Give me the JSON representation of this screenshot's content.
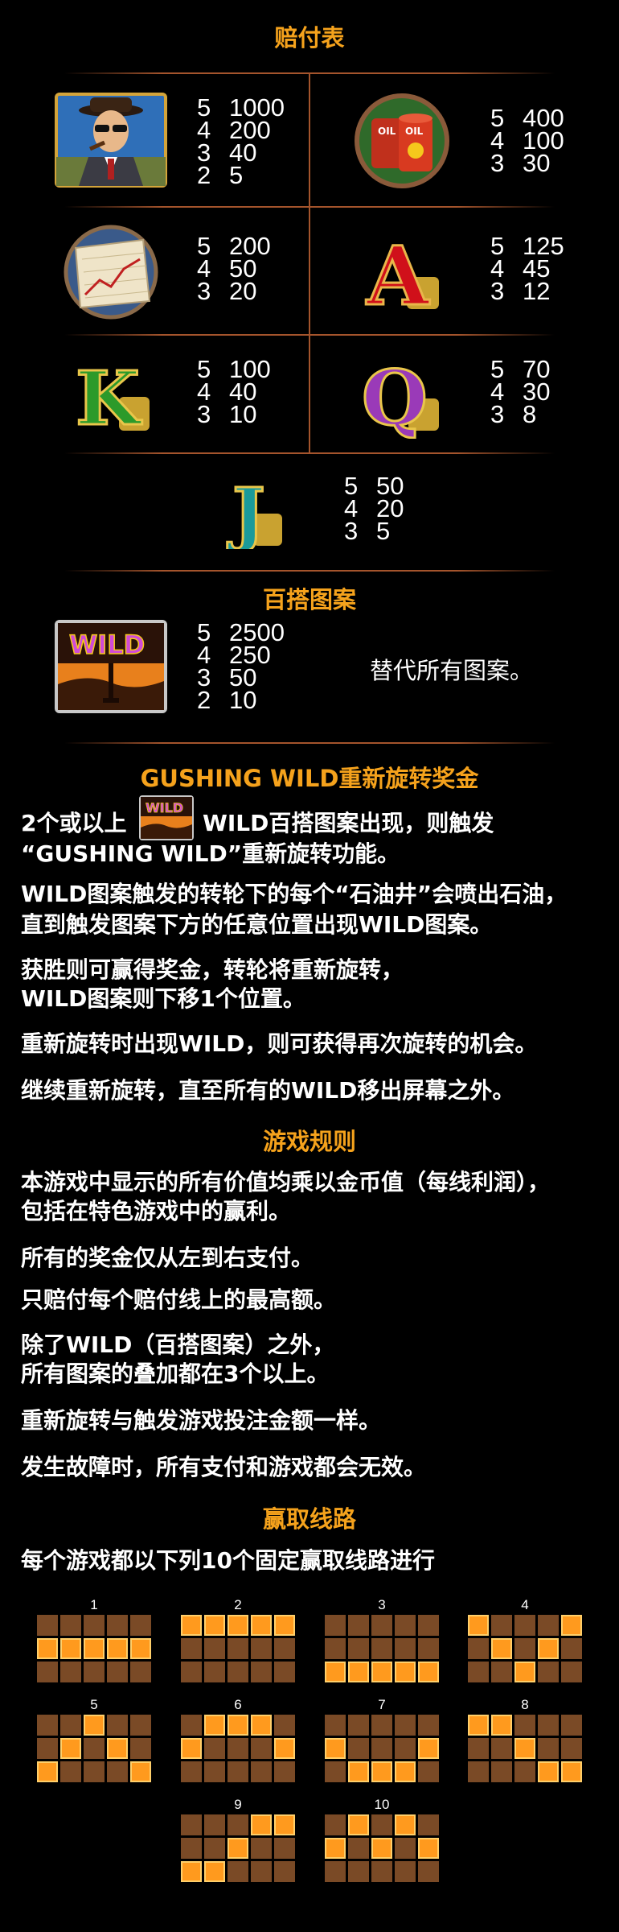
{
  "paytable_title": "赔付表",
  "symbols": [
    {
      "id": "man",
      "pays": [
        [
          "5",
          "1000"
        ],
        [
          "4",
          "200"
        ],
        [
          "3",
          "40"
        ],
        [
          "2",
          "5"
        ]
      ]
    },
    {
      "id": "barrels",
      "pays": [
        [
          "5",
          "400"
        ],
        [
          "4",
          "100"
        ],
        [
          "3",
          "30"
        ]
      ]
    },
    {
      "id": "stock",
      "pays": [
        [
          "5",
          "200"
        ],
        [
          "4",
          "50"
        ],
        [
          "3",
          "20"
        ]
      ]
    },
    {
      "id": "A",
      "pays": [
        [
          "5",
          "125"
        ],
        [
          "4",
          "45"
        ],
        [
          "3",
          "12"
        ]
      ]
    },
    {
      "id": "K",
      "pays": [
        [
          "5",
          "100"
        ],
        [
          "4",
          "40"
        ],
        [
          "3",
          "10"
        ]
      ]
    },
    {
      "id": "Q",
      "pays": [
        [
          "5",
          "70"
        ],
        [
          "4",
          "30"
        ],
        [
          "3",
          "8"
        ]
      ]
    },
    {
      "id": "J",
      "pays": [
        [
          "5",
          "50"
        ],
        [
          "4",
          "20"
        ],
        [
          "3",
          "5"
        ]
      ]
    }
  ],
  "wild_title": "百搭图案",
  "wild_logo_text": "WILD",
  "wild_pays": [
    [
      "5",
      "2500"
    ],
    [
      "4",
      "250"
    ],
    [
      "3",
      "50"
    ],
    [
      "2",
      "10"
    ]
  ],
  "wild_desc": "替代所有图案。",
  "gushing_title": "GUSHING WILD重新旋转奖金",
  "gushing_line1a": "2个或以上",
  "gushing_line1b": "WILD百搭图案出现，则触发",
  "gushing_line2": "“GUSHING WILD”重新旋转功能。",
  "gushing_p2_1": "WILD图案触发的转轮下的每个“石油井”会喷出石油，",
  "gushing_p2_2": "直到触发图案下方的任意位置出现WILD图案。",
  "gushing_p3_1": "获胜则可赢得奖金，转轮将重新旋转，",
  "gushing_p3_2": "WILD图案则下移1个位置。",
  "gushing_p4": "重新旋转时出现WILD，则可获得再次旋转的机会。",
  "gushing_p5": "继续重新旋转，直至所有的WILD移出屏幕之外。",
  "rules_title": "游戏规则",
  "rules_p1_1": "本游戏中显示的所有价值均乘以金币值（每线利润），",
  "rules_p1_2": "包括在特色游戏中的赢利。",
  "rules_p2": "所有的奖金仅从左到右支付。",
  "rules_p3": "只赔付每个赔付线上的最高额。",
  "rules_p4_1": "除了WILD（百搭图案）之外，",
  "rules_p4_2": "所有图案的叠加都在3个以上。",
  "rules_p5": "重新旋转与触发游戏投注金额一样。",
  "rules_p6": "发生故障时，所有支付和游戏都会无效。",
  "lines_title": "赢取线路",
  "lines_desc": "每个游戏都以下列10个固定赢取线路进行",
  "paylines": [
    {
      "label": "1",
      "rows": [
        1,
        1,
        1,
        1,
        1
      ]
    },
    {
      "label": "2",
      "rows": [
        0,
        0,
        0,
        0,
        0
      ]
    },
    {
      "label": "3",
      "rows": [
        2,
        2,
        2,
        2,
        2
      ]
    },
    {
      "label": "4",
      "rows": [
        0,
        1,
        2,
        1,
        0
      ]
    },
    {
      "label": "5",
      "rows": [
        2,
        1,
        0,
        1,
        2
      ]
    },
    {
      "label": "6",
      "rows": [
        1,
        0,
        0,
        0,
        1
      ]
    },
    {
      "label": "7",
      "rows": [
        1,
        2,
        2,
        2,
        1
      ]
    },
    {
      "label": "8",
      "rows": [
        0,
        0,
        1,
        2,
        2
      ]
    },
    {
      "label": "9",
      "rows": [
        2,
        2,
        1,
        0,
        0
      ]
    },
    {
      "label": "10",
      "rows": [
        1,
        0,
        1,
        0,
        1
      ]
    }
  ],
  "colors": {
    "accent": "#f5a21c",
    "divider": "#a4542c",
    "cell": "#7a4a26",
    "cell_on": "#ff9a1e"
  }
}
